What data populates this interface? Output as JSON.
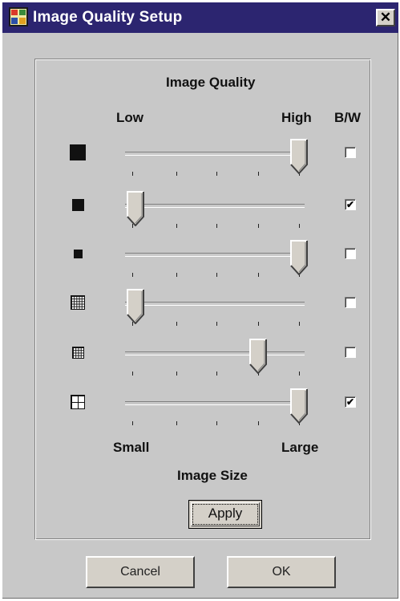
{
  "window": {
    "title": "Image Quality Setup",
    "close_label": "✕"
  },
  "group": {
    "quality_heading": "Image Quality",
    "low_label": "Low",
    "high_label": "High",
    "bw_label": "B/W",
    "small_label": "Small",
    "large_label": "Large",
    "size_heading": "Image Size",
    "apply_label": "Apply"
  },
  "rows": [
    {
      "icon": "large-solid-square-icon",
      "quality_level": 1.0,
      "bw_checked": false
    },
    {
      "icon": "medium-solid-square-icon",
      "quality_level": 0.0,
      "bw_checked": true
    },
    {
      "icon": "small-solid-square-icon",
      "quality_level": 1.0,
      "bw_checked": false
    },
    {
      "icon": "fine-grid-icon",
      "quality_level": 0.0,
      "bw_checked": false
    },
    {
      "icon": "medium-grid-icon",
      "quality_level": 0.75,
      "bw_checked": false
    },
    {
      "icon": "coarse-grid-icon",
      "quality_level": 1.0,
      "bw_checked": true
    }
  ],
  "buttons": {
    "cancel_label": "Cancel",
    "ok_label": "OK"
  },
  "checkmark": "✔",
  "colors": {
    "titlebar": "#2c2570",
    "dialog_bg": "#c8c8c8"
  }
}
